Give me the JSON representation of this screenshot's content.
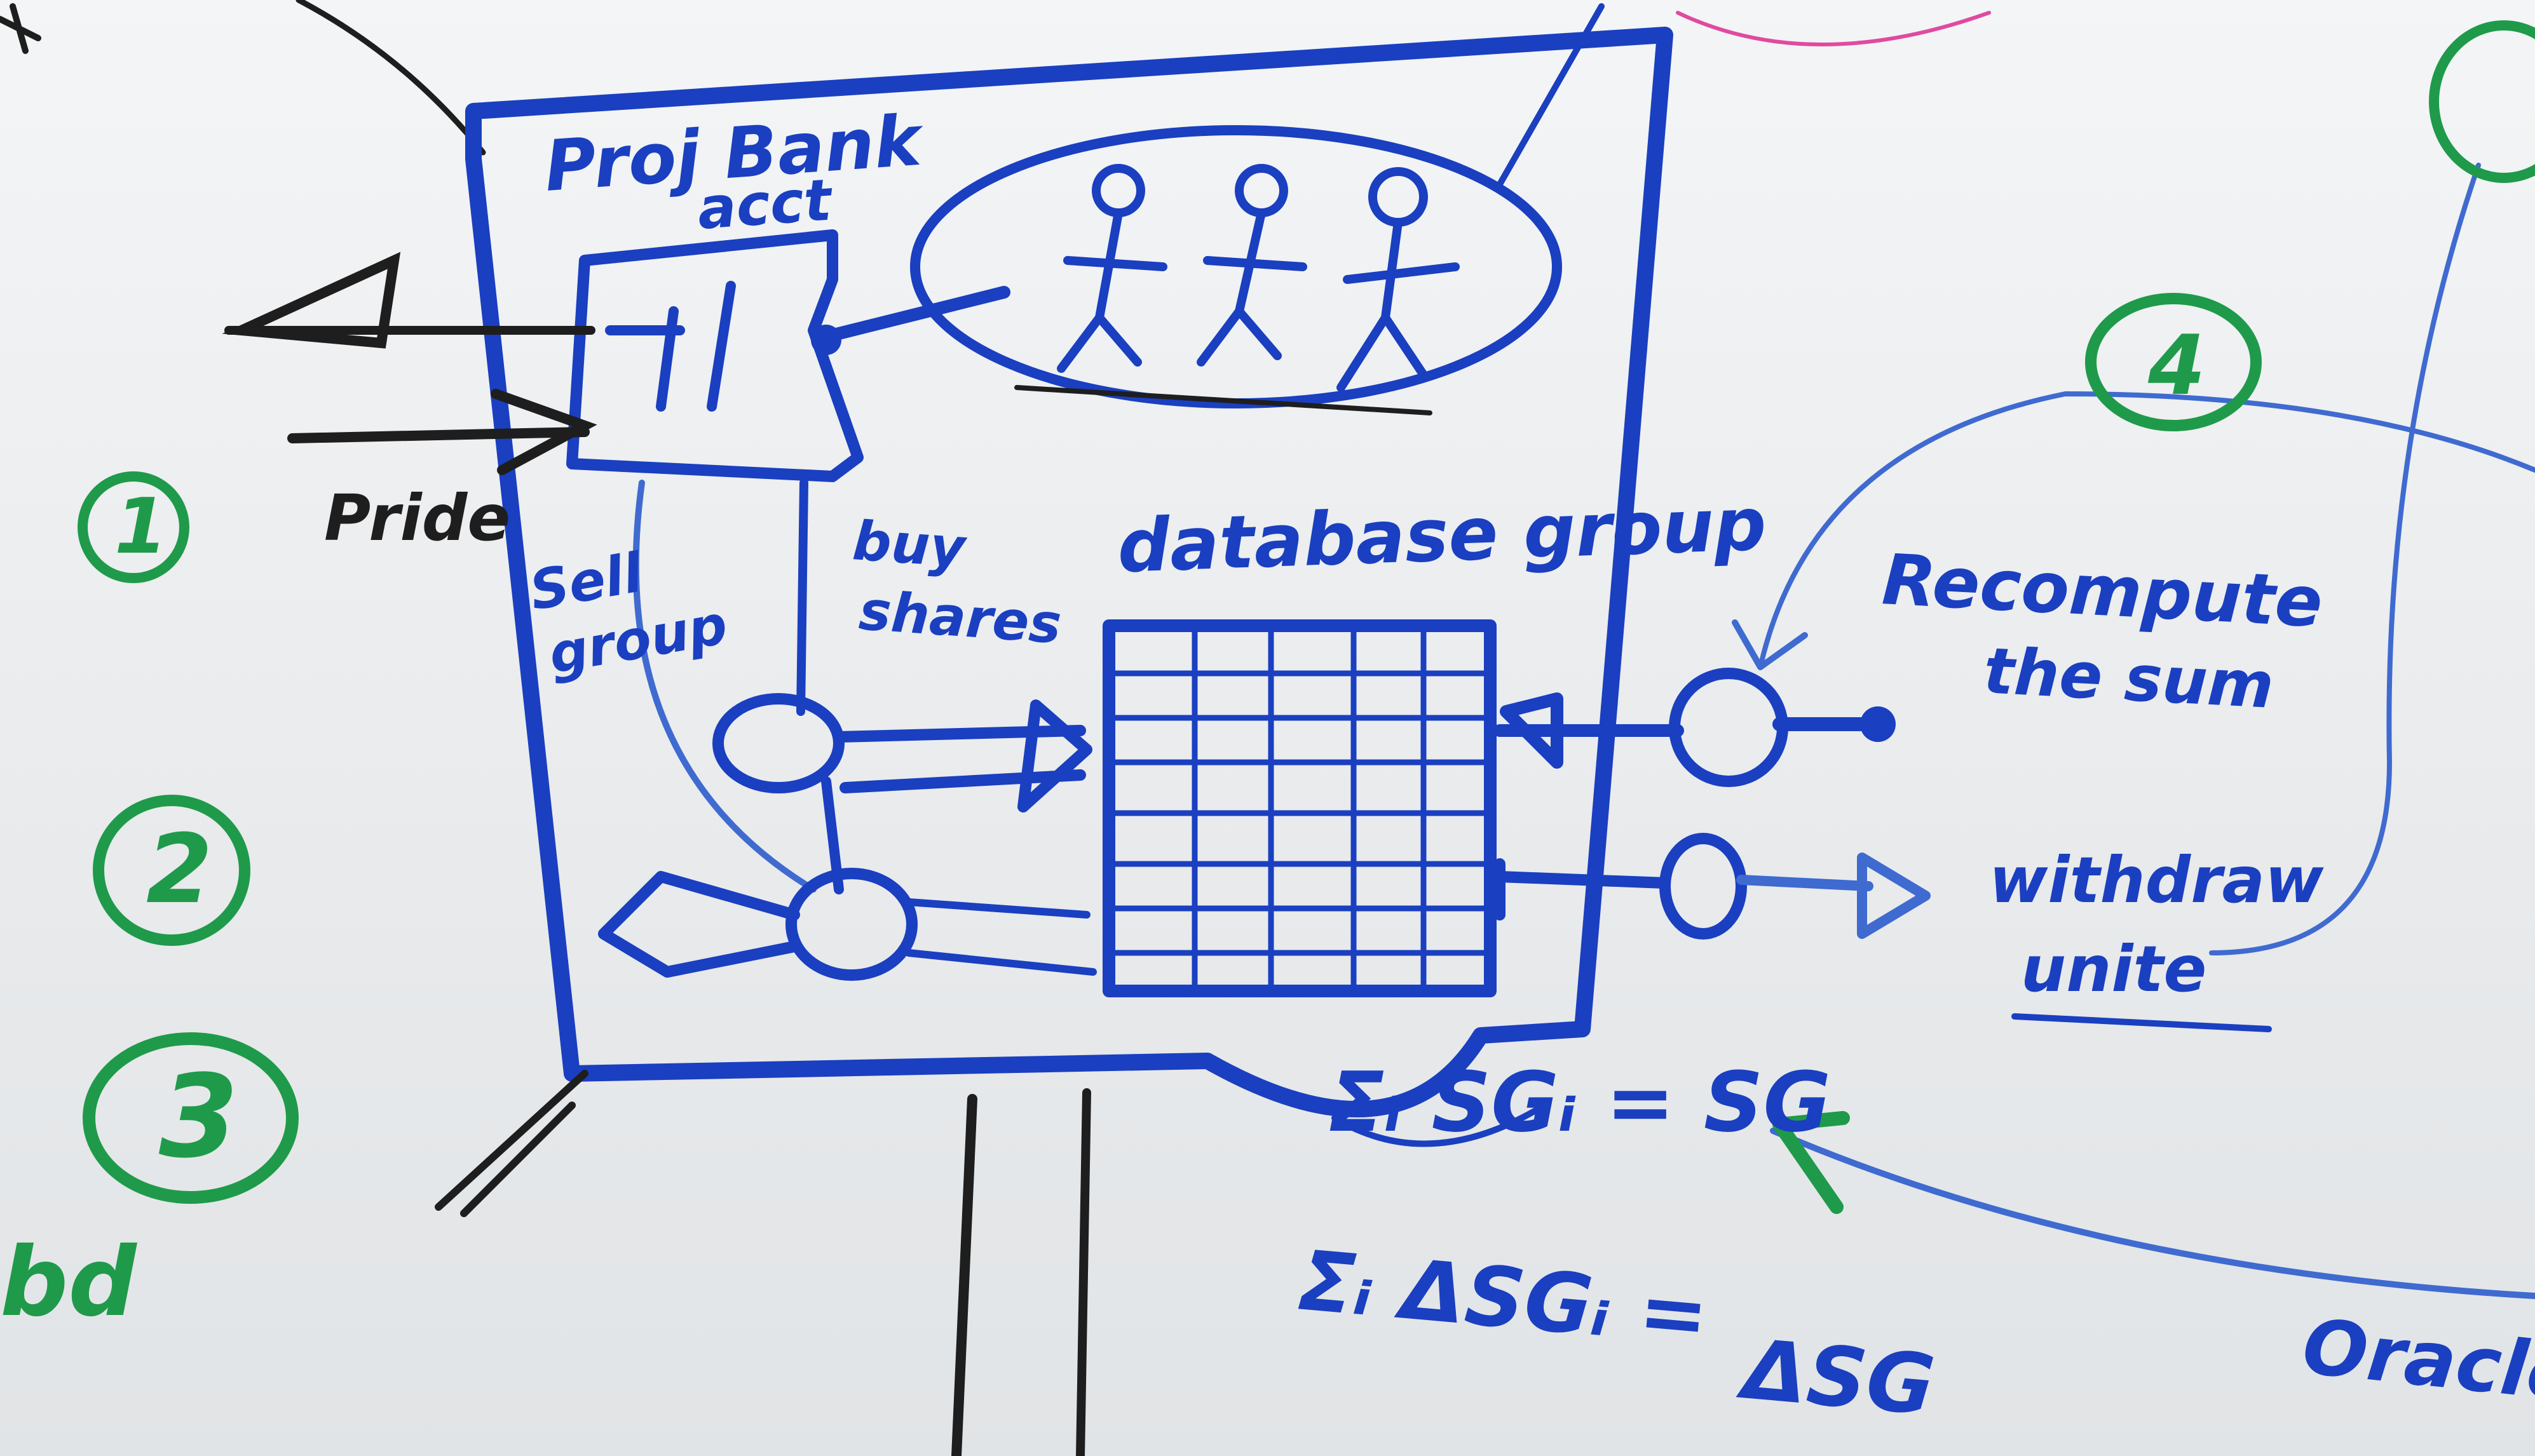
{
  "board": {
    "labels": {
      "proj_bank_acct_line1": "Proj Bank",
      "proj_bank_acct_line2": "acct",
      "database_group": "database group",
      "recompute_line1": "Recompute",
      "recompute_line2": "the sum",
      "withdraw_line1": "withdraw",
      "withdraw_line2": "unite",
      "pride": "Pride",
      "sell_group_line1": "Sell",
      "sell_group_line2": "group",
      "buy_shares_line1": "buy",
      "buy_shares_line2": "shares",
      "equation_top": "Σᵢ SGᵢ = SG",
      "equation_bottom_lhs": "Σᵢ ΔSGᵢ =",
      "equation_bottom_rhs": "ΔSG",
      "oracle": "Oracle"
    },
    "markers": {
      "green_1": "1",
      "green_2": "2",
      "green_3": "3",
      "green_4": "4"
    },
    "edge_fragments": {
      "bottom_left": "bd"
    },
    "colors": {
      "blue_marker": "#1a3fc0",
      "green_marker": "#1f9a4a",
      "black_marker": "#1e1e1e",
      "pink_marker": "#e04aa0",
      "board": "#e9ecee"
    }
  }
}
